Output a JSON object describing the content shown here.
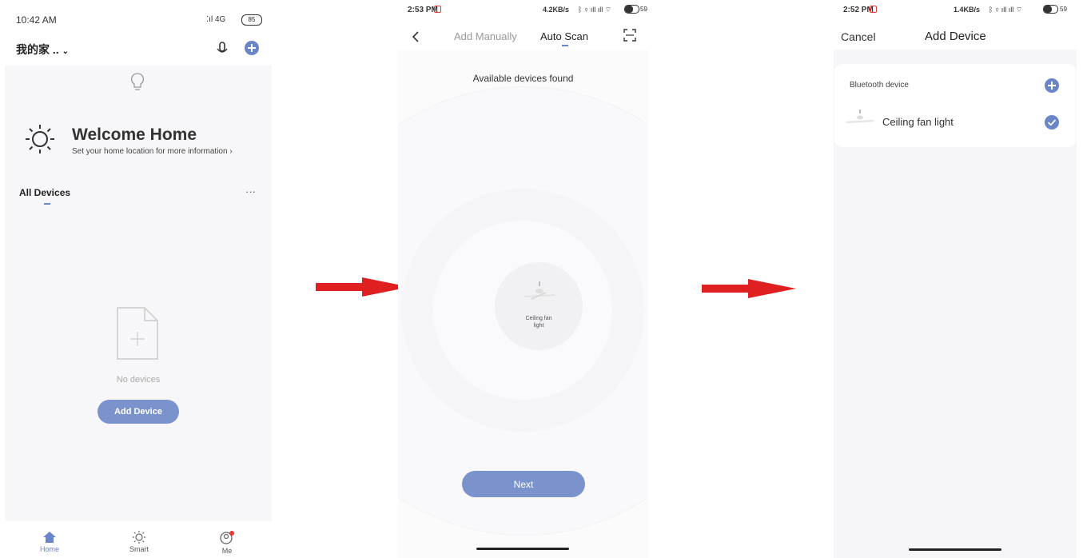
{
  "colors": {
    "accent": "#7b93cd",
    "arrow": "#e02020",
    "badge": "#e53935"
  },
  "screen1": {
    "status_time": "10:42 AM",
    "status_right": "4G",
    "battery": "85",
    "home_name": "我的家 ..",
    "welcome_title": "Welcome Home",
    "welcome_sub": "Set your home location for more information",
    "all_devices": "All Devices",
    "more": "···",
    "empty_text": "No devices",
    "add_device": "Add Device",
    "tabs": [
      {
        "label": "Home"
      },
      {
        "label": "Smart"
      },
      {
        "label": "Me"
      }
    ]
  },
  "screen2": {
    "status_time": "2:53 PM",
    "status_right": "4.2KB/s",
    "battery": "59",
    "tab_manual": "Add Manually",
    "tab_auto": "Auto Scan",
    "found": "Available devices found",
    "device_line1": "Ceiling fan",
    "device_line2": "light",
    "next": "Next"
  },
  "screen3": {
    "status_time": "2:52 PM",
    "status_right": "1.4KB/s",
    "battery": "59",
    "cancel": "Cancel",
    "title": "Add Device",
    "section": "Bluetooth device",
    "device": "Ceiling fan light"
  }
}
